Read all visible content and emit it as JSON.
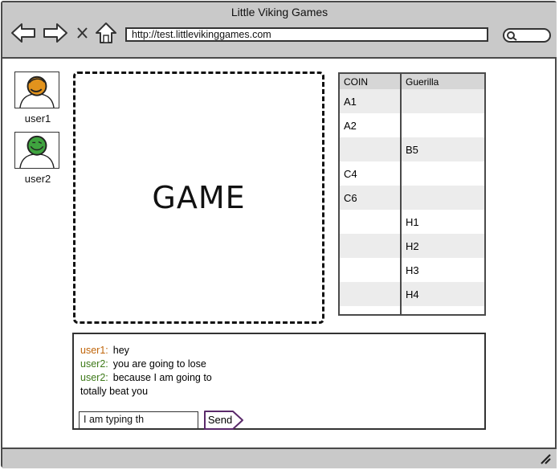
{
  "window": {
    "title": "Little Viking Games"
  },
  "nav": {
    "url": "http://test.littlevikinggames.com",
    "icons": [
      "back-arrow-icon",
      "forward-arrow-icon",
      "close-icon",
      "home-icon",
      "search-icon"
    ]
  },
  "users": [
    {
      "name": "user1",
      "avatar_color": "#e2931d"
    },
    {
      "name": "user2",
      "avatar_color": "#3fa33f"
    }
  ],
  "game": {
    "label": "GAME"
  },
  "coin_table": {
    "headers": [
      "COIN",
      "Guerilla"
    ],
    "rows": [
      [
        "A1",
        ""
      ],
      [
        "A2",
        ""
      ],
      [
        "",
        "B5"
      ],
      [
        "C4",
        ""
      ],
      [
        "C6",
        ""
      ],
      [
        "",
        "H1"
      ],
      [
        "",
        "H2"
      ],
      [
        "",
        "H3"
      ],
      [
        "",
        "H4"
      ]
    ]
  },
  "chat": {
    "messages": [
      {
        "user": "user1:",
        "text": "hey",
        "color": "#c0650a"
      },
      {
        "user": "user2:",
        "text": "you are going to lose",
        "color": "#3e7a1a"
      },
      {
        "user": "user2:",
        "text": "because I am going to totally beat you",
        "color": "#3e7a1a"
      }
    ],
    "input_value": "I am typing th",
    "send_label": "Send"
  }
}
